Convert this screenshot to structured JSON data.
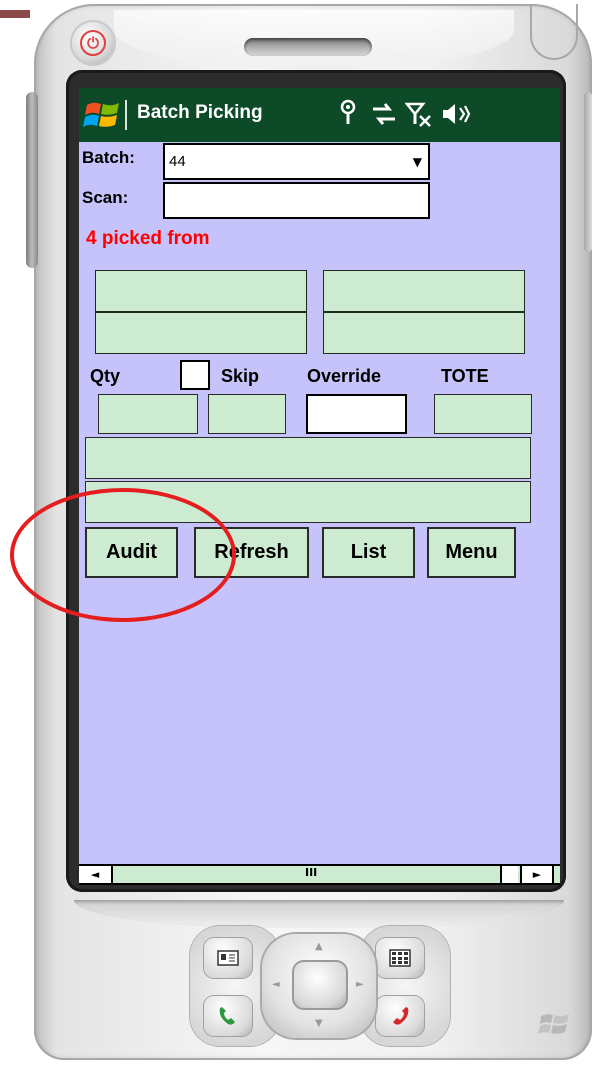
{
  "window": {
    "title": "Batch Picking",
    "status_icons": [
      "antenna-icon",
      "sync-arrows-icon",
      "no-signal-icon",
      "speaker-icon"
    ],
    "accent_title_bar": "#0d4a28",
    "screen_background": "#c6c3fa",
    "field_green": "#cdebd0"
  },
  "form": {
    "batch_label": "Batch:",
    "batch_value": "44",
    "scan_label": "Scan:",
    "scan_value": "",
    "status_message": "4 picked from",
    "status_color": "#ff0000",
    "qty_label": "Qty",
    "skip_label": "Skip",
    "skip_checked": false,
    "override_label": "Override",
    "tote_label": "TOTE"
  },
  "buttons": {
    "audit": "Audit",
    "refresh": "Refresh",
    "list": "List",
    "menu": "Menu"
  },
  "scrollbar": {
    "left_arrow": "◄",
    "right_arrow": "►",
    "grip": "III"
  },
  "annotation": {
    "color": "#e41e1e"
  }
}
